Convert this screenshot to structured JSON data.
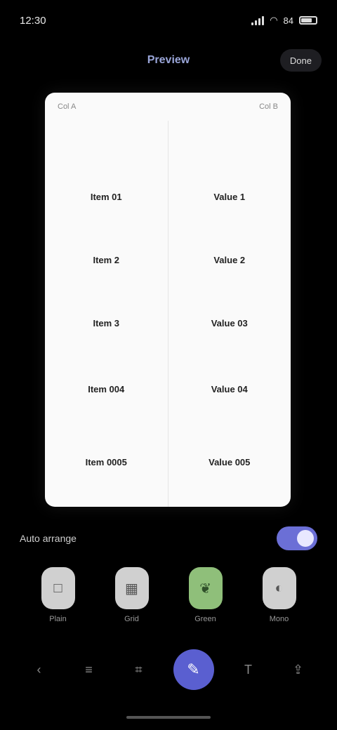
{
  "status_bar": {
    "time": "12:30",
    "signal_icon": "signal-icon",
    "wifi_icon": "wifi-icon",
    "battery_icon": "battery-icon",
    "battery_text": "84"
  },
  "top_bar": {
    "title": "Preview",
    "action_label": "Done"
  },
  "preview": {
    "header_left": "Col A",
    "header_right": "Col B",
    "left_cells": [
      "Item 01",
      "Item 2",
      "Item 3",
      "Item 004",
      "Item 0005"
    ],
    "right_cells": [
      "Value 1",
      "Value 2",
      "Value 03",
      "Value 04",
      "Value 005"
    ]
  },
  "toolbar": {
    "label": "Auto arrange",
    "toggle_state": "on"
  },
  "options": [
    {
      "label": "Plain",
      "icon": "square-icon",
      "color": "#d0d0d0"
    },
    {
      "label": "Grid",
      "icon": "grid-icon",
      "color": "#d0d0d0"
    },
    {
      "label": "Green",
      "icon": "leaf-icon",
      "color": "#8fbf7a"
    },
    {
      "label": "Mono",
      "icon": "contrast-icon",
      "color": "#d0d0d0"
    }
  ],
  "bottom_nav": [
    {
      "name": "back-icon"
    },
    {
      "name": "layers-icon"
    },
    {
      "name": "crop-icon"
    },
    {
      "name": "edit-icon",
      "active": true
    },
    {
      "name": "text-icon"
    },
    {
      "name": "share-icon"
    }
  ]
}
